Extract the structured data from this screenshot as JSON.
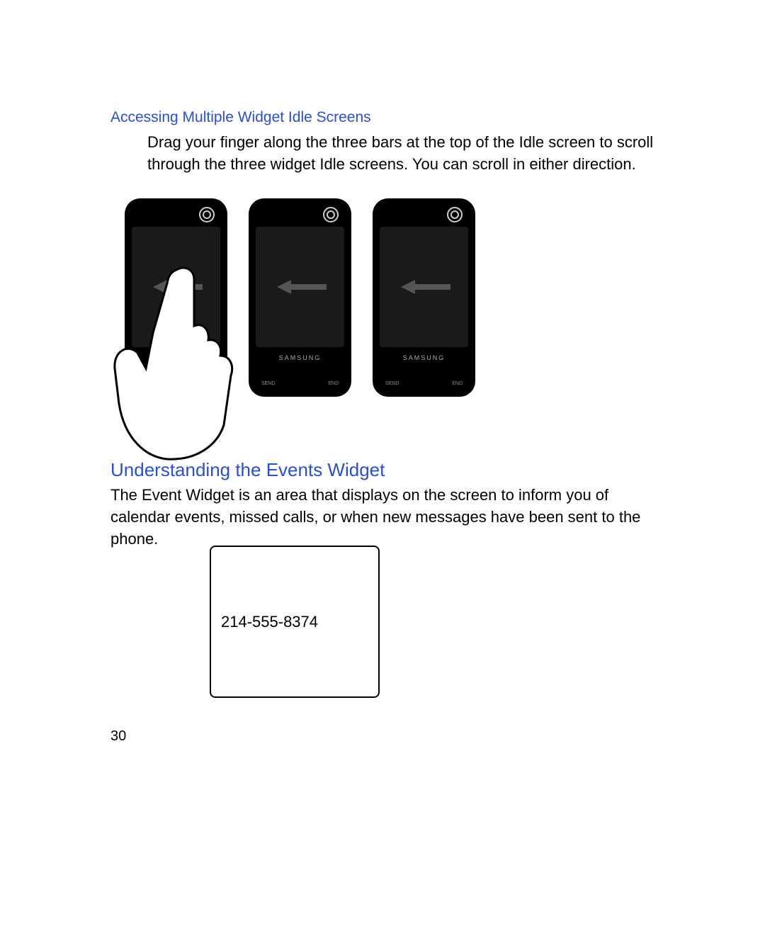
{
  "section1": {
    "heading": "Accessing Multiple Widget Idle Screens",
    "body": "Drag your finger along the three bars at the top of the Idle screen to scroll through the three widget Idle screens. You can scroll in either direction."
  },
  "phones": {
    "brand": "SAMSUNG",
    "send_label": "SEND",
    "end_label": "END"
  },
  "section2": {
    "heading": "Understanding the Events Widget",
    "body": "The Event Widget is an area that displays on the screen to inform you of calendar events, missed calls, or when new messages have been sent to the phone."
  },
  "widget": {
    "phone_number": "214-555-8374"
  },
  "page_number": "30"
}
